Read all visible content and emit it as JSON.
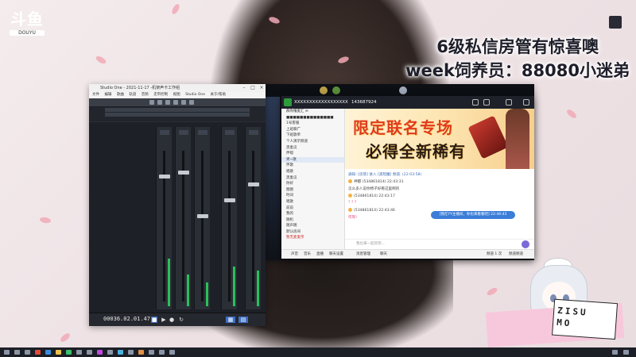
{
  "logo": {
    "mark": "斗鱼",
    "sub": "DOUYU"
  },
  "overlay": {
    "line1": "6级私信房管有惊喜噢",
    "line2": "week饲养员：88080小迷弟"
  },
  "daw": {
    "title": "Studio One - 2021-11-17 -机架声卡工作组",
    "menu": [
      "文件",
      "编辑",
      "歌曲",
      "轨道",
      "音频",
      "走带控制",
      "视图",
      "Studio One",
      "关于/帮助"
    ],
    "time": "00036.02.01.47"
  },
  "chat": {
    "group_name": "XXXXXXXXXXXXXXXXXX",
    "group_id": "143687924",
    "sidebar": [
      "群你懂麦汇 ✉",
      "■■■■■■■■■■■■■■",
      "1号客服",
      "上班聊广",
      "下班歌单",
      "个人演示频道",
      "黑麦瓜",
      "伴唱",
      "男~歌",
      "伴歌",
      "唱歌",
      "黑麦瓜",
      "你好",
      "图图",
      "时间",
      "唱歌",
      "前前",
      "我的",
      "随机",
      "随声随",
      "默认房间",
      "暂无麦麦序"
    ],
    "banner_line1": "限定联名专场",
    "banner_line2": "必得全新稀有",
    "messages": [
      "通知: [房管] 进入 [黑暗魔] 频道. (22:03:58)",
      "神都 (534861814) 22:43:31",
      "怎么多人说你椅子好看这里啊的",
      "(534861814) 22:43:17",
      "? ? ?",
      "(534861814) 22:43:46",
      "哎呀!"
    ],
    "bubble": "[我在YY主播间，你也来看看吧] 22:46:43",
    "input_placeholder": "我也来一起玩吧...",
    "status": [
      "声音",
      "音乐",
      "直播",
      "聊天设置",
      "消息管理",
      "聊天",
      "频道 1 次",
      "频道频道"
    ]
  },
  "signature": "ZISU\nMO"
}
